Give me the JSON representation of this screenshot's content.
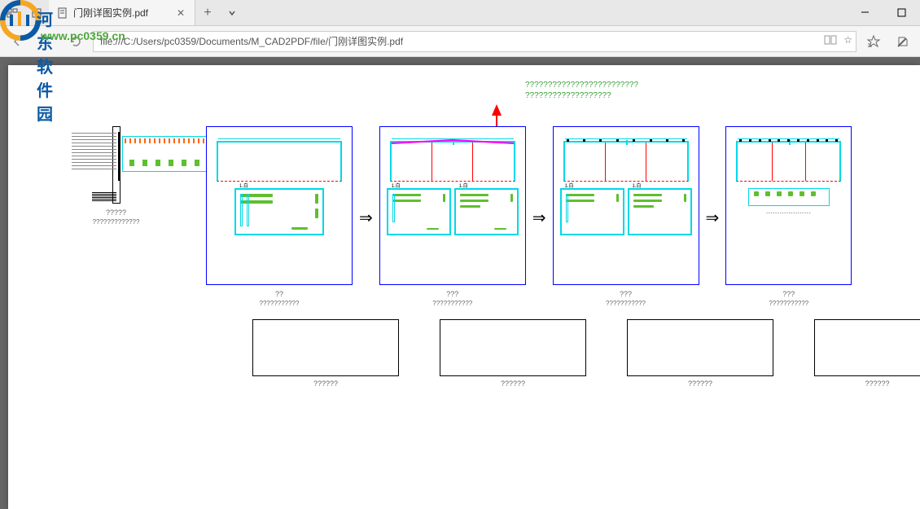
{
  "tab": {
    "title": "门刚详图实例.pdf"
  },
  "addressbar": {
    "url": "file:///C:/Users/pc0359/Documents/M_CAD2PDF/file/门刚详图实例.pdf"
  },
  "watermark": {
    "brand": "河东软件园",
    "url": "www.pc0359.cn"
  },
  "page": {
    "green_header_line1": "?????????????????????????",
    "green_header_line2": "???????????????????",
    "first_caption": "?????",
    "first_subcaption": "?????????????",
    "diagrams": [
      {
        "caption": "??",
        "subcaption": "???????????"
      },
      {
        "caption": "???",
        "subcaption": "???????????"
      },
      {
        "caption": "???",
        "subcaption": "???????????"
      },
      {
        "caption": "???",
        "subcaption": "???????????"
      }
    ],
    "bottom_boxes": [
      {
        "caption": "??????"
      },
      {
        "caption": "??????"
      },
      {
        "caption": "??????"
      },
      {
        "caption": "??????"
      }
    ]
  }
}
